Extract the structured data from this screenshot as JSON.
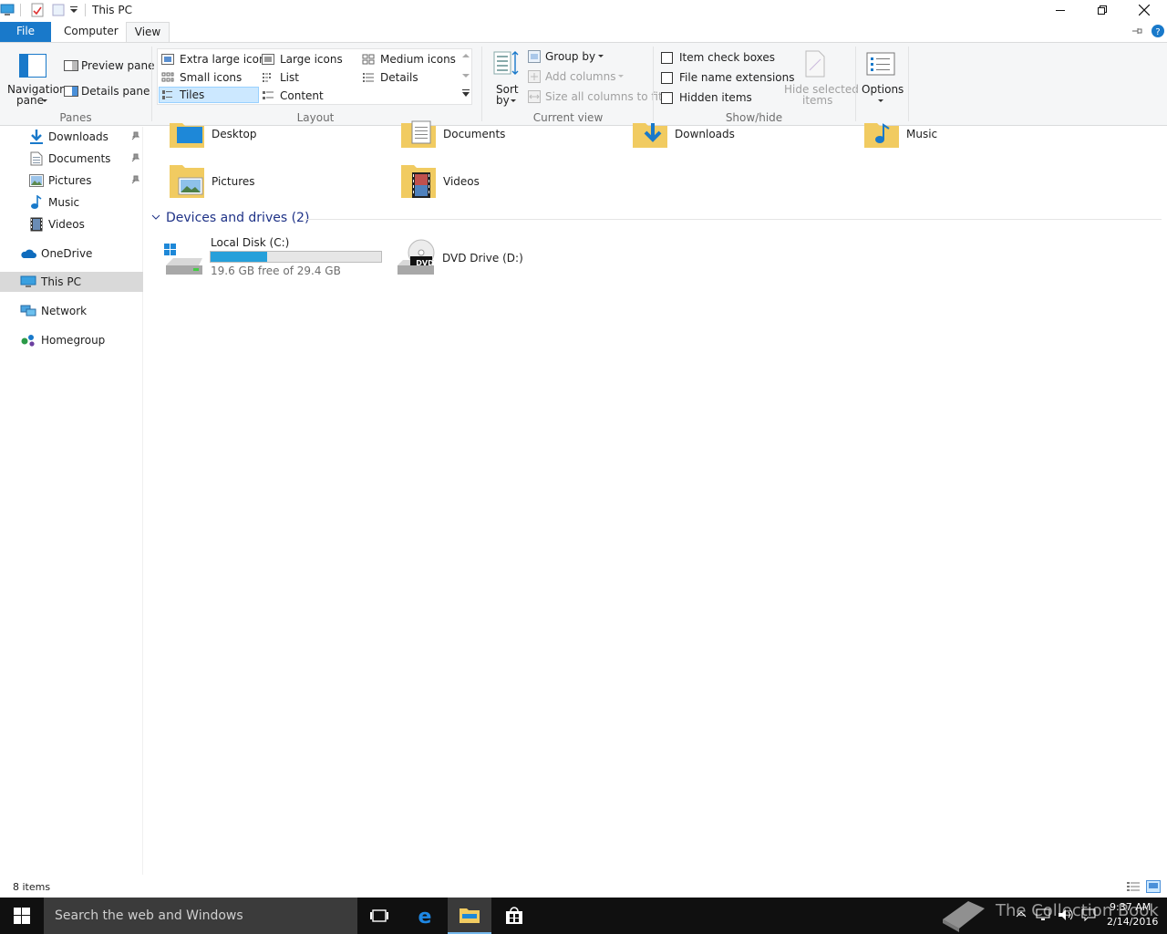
{
  "window": {
    "title": "This PC"
  },
  "ribbon_tabs": {
    "file": "File",
    "computer": "Computer",
    "view": "View"
  },
  "panes": {
    "navigation_pane": "Navigation",
    "navigation_pane_2": "pane",
    "preview_pane": "Preview pane",
    "details_pane": "Details pane",
    "group_label": "Panes"
  },
  "layout": {
    "extra_large_icons": "Extra large icons",
    "large_icons": "Large icons",
    "medium_icons": "Medium icons",
    "small_icons": "Small icons",
    "list": "List",
    "details": "Details",
    "tiles": "Tiles",
    "content": "Content",
    "group_label": "Layout"
  },
  "current_view": {
    "sort_by": "Sort",
    "sort_by_2": "by",
    "group_by": "Group by",
    "add_columns": "Add columns",
    "size_all_columns": "Size all columns to fit",
    "group_label": "Current view"
  },
  "show_hide": {
    "item_check_boxes": "Item check boxes",
    "file_name_extensions": "File name extensions",
    "hidden_items": "Hidden items",
    "hide_selected_items": "Hide selected",
    "hide_selected_items_2": "items",
    "group_label": "Show/hide"
  },
  "options": {
    "label": "Options"
  },
  "nav": {
    "items": [
      {
        "label": "Downloads",
        "pinned": true
      },
      {
        "label": "Documents",
        "pinned": true
      },
      {
        "label": "Pictures",
        "pinned": true
      },
      {
        "label": "Music"
      },
      {
        "label": "Videos"
      },
      {
        "label": "OneDrive"
      },
      {
        "label": "This PC",
        "selected": true
      },
      {
        "label": "Network"
      },
      {
        "label": "Homegroup"
      }
    ]
  },
  "folders": {
    "items": [
      "Desktop",
      "Documents",
      "Downloads",
      "Music",
      "Pictures",
      "Videos"
    ]
  },
  "devices": {
    "header": "Devices and drives (2)",
    "local_disk": {
      "name": "Local Disk (C:)",
      "free_text": "19.6 GB free of 29.4 GB",
      "used_fraction": 0.333
    },
    "dvd": {
      "name": "DVD Drive (D:)",
      "badge": "DVD"
    }
  },
  "status": {
    "count": "8 items"
  },
  "taskbar": {
    "search_placeholder": "Search the web and Windows",
    "time": "9:37 AM",
    "date": "2/14/2016",
    "watermark": "The Collection Book"
  },
  "colors": {
    "accent": "#1979ca",
    "selection": "#cce8ff",
    "group_header": "#1e3287",
    "disk_bar": "#26a0da"
  }
}
